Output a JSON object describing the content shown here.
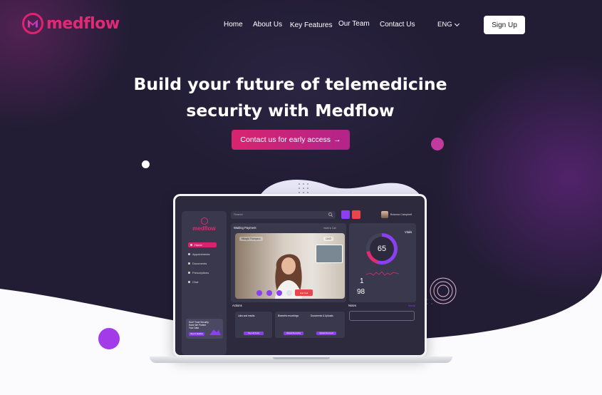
{
  "brand": {
    "name": "medflow",
    "color": "#e02b74"
  },
  "nav": {
    "links": [
      "Home",
      "About Us",
      "Key Features",
      "Our Team",
      "Contact Us"
    ],
    "language": "ENG",
    "signup_label": "Sign Up"
  },
  "hero": {
    "title_line1": "Build your future of telemedicine",
    "title_line2": "security with Medflow",
    "cta_label": "Contact us for early access",
    "cta_arrow": "→"
  },
  "app": {
    "brand": "medflow",
    "search_placeholder": "Search",
    "user_name": "Brianna Campbell",
    "sidebar": [
      {
        "label": "Home",
        "icon": "home-icon",
        "active": true
      },
      {
        "label": "Appointments",
        "icon": "calendar-icon",
        "active": false
      },
      {
        "label": "Documents",
        "icon": "folder-icon",
        "active": false
      },
      {
        "label": "Prescriptions",
        "icon": "pill-icon",
        "active": false
      },
      {
        "label": "Chat",
        "icon": "chat-icon",
        "active": false
      }
    ],
    "promo": {
      "text": "Don't Trust Security, Have We Protect Your Data",
      "button": "View in Medflow"
    },
    "call": {
      "header": "Waiting Payment",
      "badge": "1",
      "invite": "Invite to Call",
      "caller": "Mikayla Thompson",
      "timer": "10:03",
      "end_label": "End Call"
    },
    "vitals": {
      "title": "Vitals",
      "heart_rate": "65",
      "stat1": "1",
      "stat2": "98"
    },
    "actions": {
      "title": "Actions",
      "cards": [
        {
          "title": "Labs and results",
          "button": "See Lab Tests"
        },
        {
          "title": "Biometric recordings",
          "button": "Upload Recording"
        },
        {
          "title": "Documents & Uploads",
          "button": "Upload Document"
        }
      ]
    },
    "notes": {
      "title": "Notes",
      "see_all": "See All"
    }
  },
  "colors": {
    "bg": "#221d35",
    "accent": "#d8246f",
    "purple": "#8a3ff0"
  }
}
